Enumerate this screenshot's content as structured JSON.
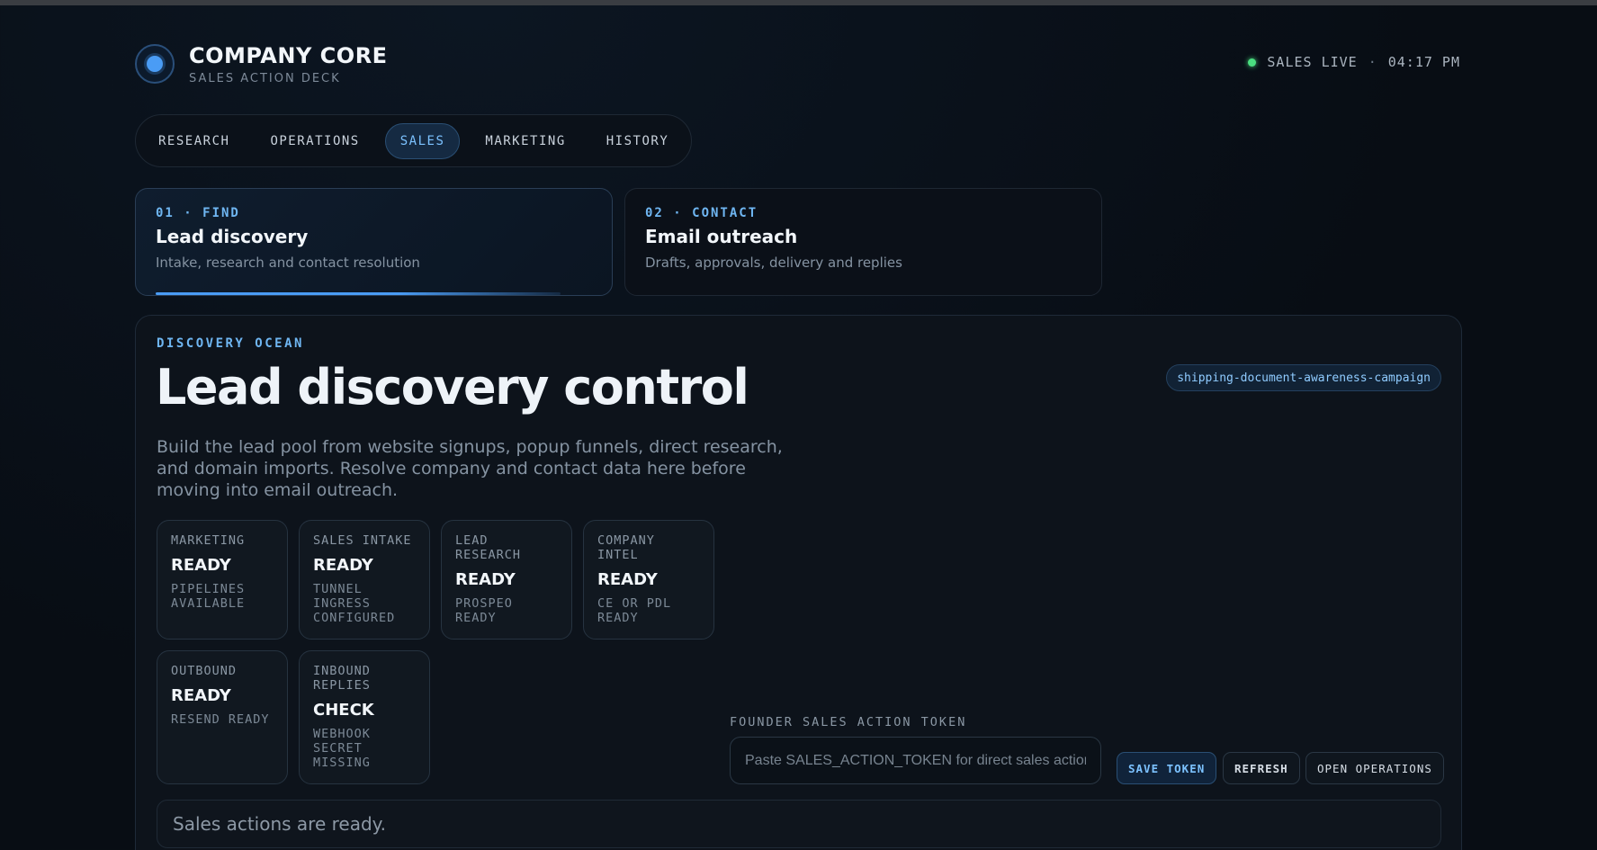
{
  "header": {
    "title": "COMPANY CORE",
    "subtitle": "SALES ACTION DECK",
    "status": {
      "label": "SALES LIVE",
      "separator": "·",
      "time": "04:17 PM",
      "color": "#4ade80"
    }
  },
  "nav": {
    "tabs": [
      {
        "label": "RESEARCH",
        "active": false
      },
      {
        "label": "OPERATIONS",
        "active": false
      },
      {
        "label": "SALES",
        "active": true
      },
      {
        "label": "MARKETING",
        "active": false
      },
      {
        "label": "HISTORY",
        "active": false
      }
    ]
  },
  "steps": [
    {
      "kicker": "01 · FIND",
      "title": "Lead discovery",
      "desc": "Intake, research and contact resolution",
      "active": true
    },
    {
      "kicker": "02 · CONTACT",
      "title": "Email outreach",
      "desc": "Drafts, approvals, delivery and replies",
      "active": false
    }
  ],
  "panel": {
    "kicker": "DISCOVERY OCEAN",
    "title": "Lead discovery control",
    "campaign": "shipping-document-awareness-campaign",
    "description": "Build the lead pool from website signups, popup funnels, direct research, and domain imports. Resolve company and contact data here before moving into email outreach.",
    "cards": [
      {
        "label": "MARKETING",
        "state": "READY",
        "detail": "PIPELINES AVAILABLE"
      },
      {
        "label": "SALES INTAKE",
        "state": "READY",
        "detail": "TUNNEL INGRESS CONFIGURED"
      },
      {
        "label": "LEAD RESEARCH",
        "state": "READY",
        "detail": "PROSPEO READY"
      },
      {
        "label": "COMPANY INTEL",
        "state": "READY",
        "detail": "CE OR PDL READY"
      },
      {
        "label": "OUTBOUND",
        "state": "READY",
        "detail": "RESEND READY"
      },
      {
        "label": "INBOUND REPLIES",
        "state": "CHECK",
        "detail": "WEBHOOK SECRET MISSING"
      }
    ],
    "token": {
      "label": "FOUNDER SALES ACTION TOKEN",
      "value": "",
      "placeholder": "Paste SALES_ACTION_TOKEN for direct sales actions"
    },
    "buttons": {
      "save": "SAVE TOKEN",
      "refresh": "REFRESH",
      "open_operations": "OPEN OPERATIONS"
    },
    "status_message": "Sales actions are ready."
  },
  "colors": {
    "accent": "#4a9cf5",
    "accent_text": "#6fb6f2",
    "background": "#080d14",
    "live": "#4ade80"
  }
}
